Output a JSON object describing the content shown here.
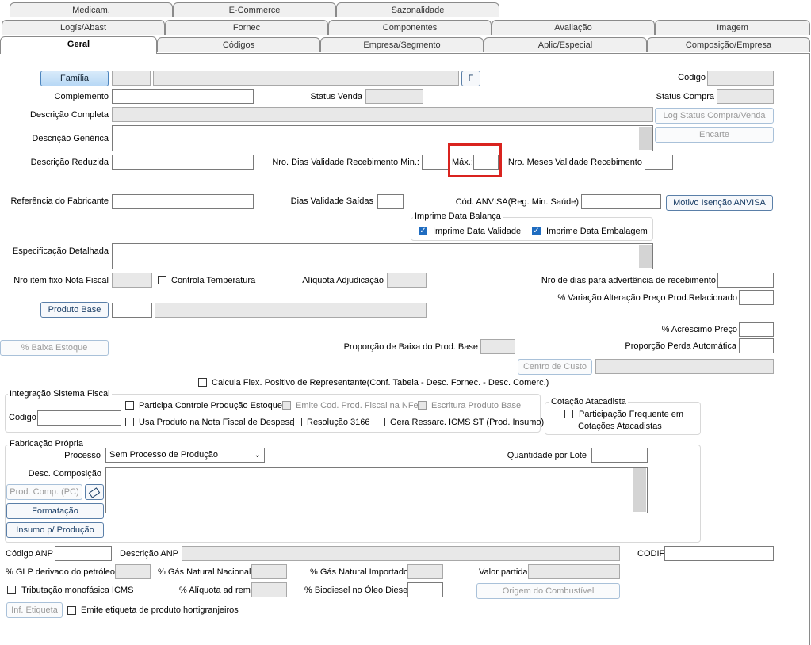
{
  "tabs": {
    "row1": [
      "Medicam.",
      "E-Commerce",
      "Sazonalidade"
    ],
    "row2": [
      "Logís/Abast",
      "Fornec",
      "Componentes",
      "Avaliação",
      "Imagem"
    ],
    "row3": [
      "Geral",
      "Códigos",
      "Empresa/Segmento",
      "Aplic/Especial",
      "Composição/Empresa"
    ]
  },
  "form": {
    "familia_btn": "Família",
    "f_btn": "F",
    "codigo": "Codigo",
    "complemento": "Complemento",
    "status_venda": "Status Venda",
    "status_compra": "Status Compra",
    "descricao_completa": "Descrição Completa",
    "log_status_btn": "Log Status Compra/Venda",
    "descricao_generica": "Descrição Genérica",
    "encarte_btn": "Encarte",
    "descricao_reduzida": "Descrição Reduzida",
    "nro_dias_validade_min": "Nro. Dias Validade Recebimento Min.:",
    "max": "Máx.:",
    "nro_meses_validade": "Nro. Meses Validade Recebimento",
    "referencia_fabricante": "Referência do Fabricante",
    "dias_validade_saidas": "Dias Validade Saídas",
    "cod_anvisa": "Cód. ANVISA(Reg. Min. Saúde)",
    "motivo_isencao_btn": "Motivo Isenção ANVISA",
    "imprime_data_balanca": "Imprime Data Balança",
    "imprime_data_validade": "Imprime Data Validade",
    "imprime_data_embalagem": "Imprime Data Embalagem",
    "especificacao_detalhada": "Especificação Detalhada",
    "nro_item_fixo": "Nro item fixo Nota Fiscal",
    "controla_temperatura": "Controla Temperatura",
    "aliquota_adjudicacao": "Alíquota Adjudicação",
    "nro_dias_advertencia": "Nro de dias para advertência de recebimento",
    "variacao_alteracao": "% Variação Alteração Preço Prod.Relacionado",
    "produto_base_btn": "Produto Base",
    "acrescimo_preco": "% Acréscimo Preço",
    "baixa_estoque_btn": "% Baixa Estoque",
    "proporcao_baixa": "Proporção de Baixa do Prod. Base",
    "proporcao_perda": "Proporção Perda Automática",
    "centro_custo_btn": "Centro de Custo",
    "calcula_flex": "Calcula Flex. Positivo de Representante(Conf. Tabela - Desc. Fornec. - Desc. Comerc.)"
  },
  "integracao": {
    "title": "Integração Sistema Fiscal",
    "codigo": "Codigo",
    "participa_controle": "Participa Controle Produção Estoque",
    "emite_cod": "Emite Cod. Prod. Fiscal na NFe",
    "escritura_produto": "Escritura Produto Base",
    "usa_produto": "Usa Produto na Nota Fiscal de Despesa",
    "resolucao": "Resolução 3166",
    "gera_ressarc": "Gera Ressarc. ICMS ST (Prod. Insumo)"
  },
  "cotacao": {
    "title": "Cotação Atacadista",
    "participacao_line1": "Participação Frequente em",
    "participacao_line2": "Cotações Atacadistas"
  },
  "fabricacao": {
    "title": "Fabricação Própria",
    "processo": "Processo",
    "processo_value": "Sem Processo de Produção",
    "quantidade_lote": "Quantidade por Lote",
    "desc_composicao": "Desc. Composição",
    "prod_comp_btn": "Prod. Comp. (PC)",
    "formatacao_btn": "Formatação",
    "insumo_btn": "Insumo p/ Produção"
  },
  "anp": {
    "codigo_anp": "Código ANP",
    "descricao_anp": "Descrição ANP",
    "codif": "CODIF",
    "glp": "% GLP derivado do petróleo",
    "gas_nacional": "% Gás Natural Nacional",
    "gas_importado": "% Gás Natural Importado",
    "valor_partida": "Valor partida",
    "tributacao": "Tributação monofásica ICMS",
    "aliquota_ad_rem": "% Alíquota ad rem",
    "biodiesel": "% Biodiesel no Óleo Diesel",
    "origem_btn": "Origem do Combustível",
    "inf_etiqueta_btn": "Inf. Etiqueta",
    "emite_etiqueta": "Emite etiqueta de produto hortigranjeiros"
  },
  "colors": {
    "highlight": "#d9231f",
    "accent": "#1f6cc0"
  }
}
